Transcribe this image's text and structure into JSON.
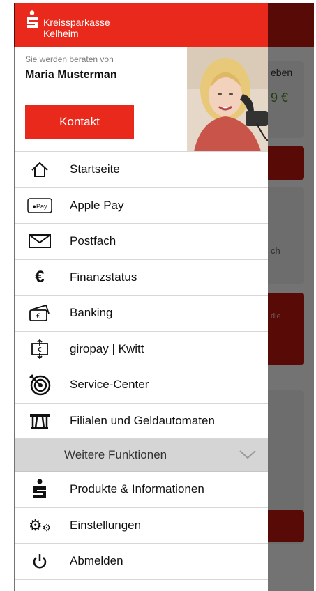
{
  "brand": {
    "name_line1": "Kreissparkasse",
    "name_line2": "Kelheim"
  },
  "advisor": {
    "subtitle": "Sie werden beraten von",
    "name": "Maria Musterman",
    "contact_label": "Kontakt"
  },
  "menu": [
    {
      "label": "Startseite",
      "icon": "home-icon"
    },
    {
      "label": "Apple Pay",
      "icon": "apple-pay-icon"
    },
    {
      "label": "Postfach",
      "icon": "mail-icon"
    },
    {
      "label": "Finanzstatus",
      "icon": "euro-icon"
    },
    {
      "label": "Banking",
      "icon": "wallet-euro-icon"
    },
    {
      "label": "giropay | Kwitt",
      "icon": "transfer-icon"
    },
    {
      "label": "Service-Center",
      "icon": "target-icon"
    },
    {
      "label": "Filialen und Geldautomaten",
      "icon": "atm-icon"
    }
  ],
  "section": {
    "label": "Weitere Funktionen"
  },
  "more_menu": [
    {
      "label": "Produkte & Informationen",
      "icon": "sparkasse-logo-icon"
    },
    {
      "label": "Einstellungen",
      "icon": "gears-icon"
    },
    {
      "label": "Abmelden",
      "icon": "power-icon"
    }
  ],
  "background": {
    "label_top": "eben",
    "amount_partial": "9 €",
    "postfach_partial": "ch",
    "red_card_partial": "die"
  },
  "colors": {
    "brand_red": "#e8291c",
    "dark_red": "#c4190f"
  }
}
